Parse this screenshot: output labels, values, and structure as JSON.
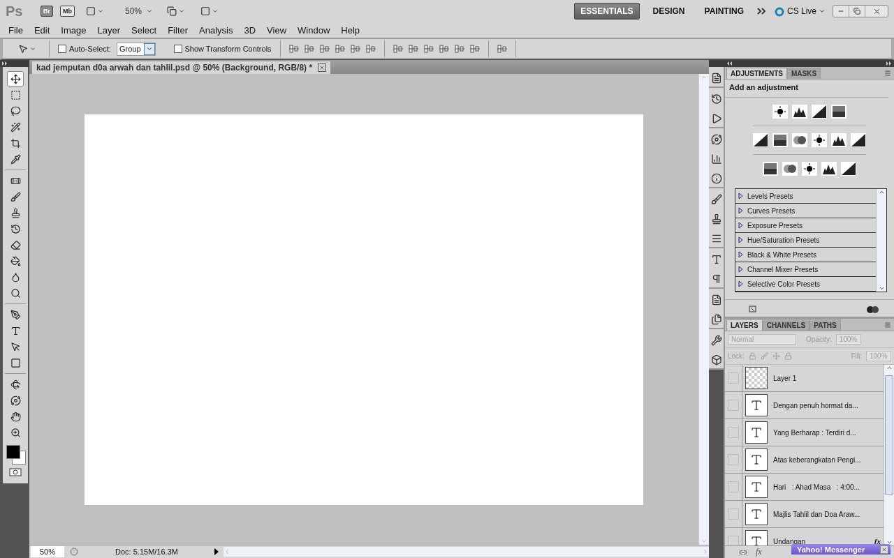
{
  "app_bar": {
    "logo": "Ps",
    "bridge_button": "Br",
    "mini_bridge_button": "Mb",
    "zoom": "50%",
    "workspaces": [
      {
        "label": "ESSENTIALS",
        "selected": true
      },
      {
        "label": "DESIGN",
        "selected": false
      },
      {
        "label": "PAINTING",
        "selected": false
      }
    ],
    "cs_live": "CS Live"
  },
  "menu": [
    "File",
    "Edit",
    "Image",
    "Layer",
    "Select",
    "Filter",
    "Analysis",
    "3D",
    "View",
    "Window",
    "Help"
  ],
  "options_bar": {
    "auto_select": {
      "label": "Auto-Select:",
      "checked": false
    },
    "auto_select_target": "Group",
    "transform_controls": {
      "label": "Show Transform Controls",
      "checked": false
    }
  },
  "tools": [
    [
      {
        "selected": true
      },
      {
        "selected": false
      },
      {
        "selected": false
      },
      {
        "selected": false
      },
      {
        "selected": false
      },
      {
        "selected": false
      }
    ],
    [
      {
        "selected": false
      },
      {
        "selected": false
      },
      {
        "selected": false
      },
      {
        "selected": false
      },
      {
        "selected": false
      },
      {
        "selected": false
      },
      {
        "selected": false
      },
      {
        "selected": false
      }
    ],
    [
      {
        "selected": false
      },
      {
        "selected": false
      },
      {
        "selected": false
      },
      {
        "selected": false
      }
    ],
    [
      {
        "selected": false
      },
      {
        "selected": false
      },
      {
        "selected": false
      },
      {
        "selected": false
      }
    ]
  ],
  "document": {
    "tab_title": "kad jemputan d0a arwah dan tahlil.psd @ 50% (Background, RGB/8) *",
    "zoom": "50%",
    "doc_info": "Doc: 5.15M/16.3M"
  },
  "adjustments_panel": {
    "tabs": [
      {
        "label": "ADJUSTMENTS",
        "selected": true
      },
      {
        "label": "MASKS",
        "selected": false
      }
    ],
    "heading": "Add an adjustment",
    "presets": [
      {
        "label": "Levels Presets",
        "expanded": false
      },
      {
        "label": "Curves Presets",
        "expanded": false
      },
      {
        "label": "Exposure Presets",
        "expanded": false
      },
      {
        "label": "Hue/Saturation Presets",
        "expanded": false
      },
      {
        "label": "Black & White Presets",
        "expanded": false
      },
      {
        "label": "Channel Mixer Presets",
        "expanded": false
      },
      {
        "label": "Selective Color Presets",
        "expanded": false
      }
    ]
  },
  "layers_panel": {
    "tabs": [
      {
        "label": "LAYERS",
        "selected": true
      },
      {
        "label": "CHANNELS",
        "selected": false
      },
      {
        "label": "PATHS",
        "selected": false
      }
    ],
    "blend_mode": "Normal",
    "opacity_label": "Opacity:",
    "opacity": "100%",
    "lock_label": "Lock:",
    "fill_label": "Fill:",
    "fill": "100%",
    "disabled": true,
    "layers": [
      {
        "kind": "pixel",
        "name": "Layer 1",
        "visible": false
      },
      {
        "kind": "text",
        "name": "Dengan penuh hormat da...",
        "visible": false
      },
      {
        "kind": "text",
        "name": "Yang Berharap : Terdiri d...",
        "visible": false
      },
      {
        "kind": "text",
        "name": "Atas keberangkatan Pengi...",
        "visible": false
      },
      {
        "kind": "text",
        "name": "Hari   : Ahad Masa   : 4:00...",
        "visible": false
      },
      {
        "kind": "text",
        "name": "Majlis Tahlil dan Doa Araw...",
        "visible": false
      },
      {
        "kind": "text",
        "name": "Undangan",
        "visible": false,
        "badge": "fx"
      }
    ],
    "footer_fx": "fx"
  },
  "notification": {
    "title": "Yahoo! Messenger"
  }
}
